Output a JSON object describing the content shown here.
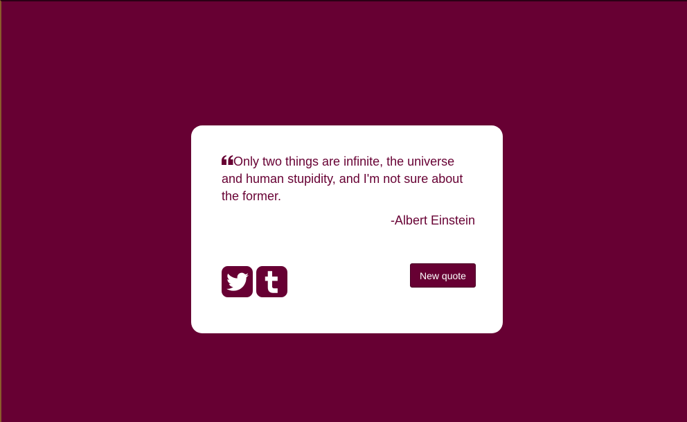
{
  "quote": {
    "text": "Only two things are infinite, the universe and human stupidity, and I'm not sure about the former.",
    "author": "-Albert Einstein",
    "mark_icon": "quote-left-icon"
  },
  "social": {
    "twitter_icon": "twitter-icon",
    "tumblr_icon": "tumblr-icon"
  },
  "actions": {
    "new_quote_label": "New quote"
  },
  "colors": {
    "background": "#670033",
    "card": "#ffffff",
    "accent": "#670033"
  }
}
